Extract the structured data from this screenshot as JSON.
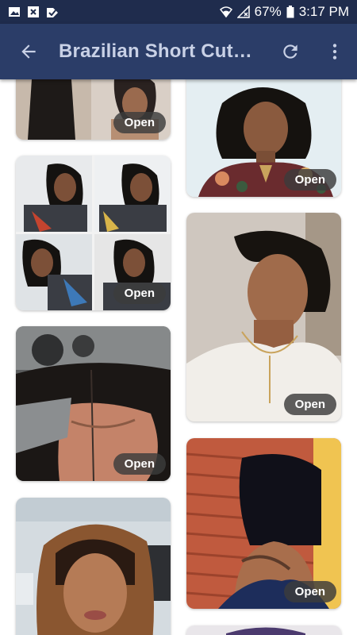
{
  "status_bar": {
    "battery": "67%",
    "time": "3:17 PM",
    "notification_icons": [
      "image-icon",
      "close-box-icon",
      "check-send-icon"
    ]
  },
  "app_bar": {
    "title": "Brazilian Short Cut…",
    "back_icon": "arrow-back-icon",
    "refresh_icon": "refresh-icon",
    "menu_icon": "more-vert-icon"
  },
  "gallery": {
    "open_label": "Open",
    "items": [
      {
        "id": "img-1",
        "subject": "Black top, side view"
      },
      {
        "id": "img-2",
        "subject": "Short bob, floral jacket"
      },
      {
        "id": "img-3",
        "subject": "Collage of four photos, graphic tee"
      },
      {
        "id": "img-4",
        "subject": "Side-swept short cut, white sweater"
      },
      {
        "id": "img-5",
        "subject": "Lace front wig closeup"
      },
      {
        "id": "img-6",
        "subject": "Sleek bob, tattooed shoulder"
      },
      {
        "id": "img-7",
        "subject": "Ombre long hair selfie"
      },
      {
        "id": "img-8",
        "subject": "Partially visible photo"
      }
    ]
  },
  "colors": {
    "status_bar": "#1f2c4d",
    "app_bar": "#2b3d68",
    "title_text": "#c9d1e6",
    "open_button_bg": "#3c3c3c"
  }
}
